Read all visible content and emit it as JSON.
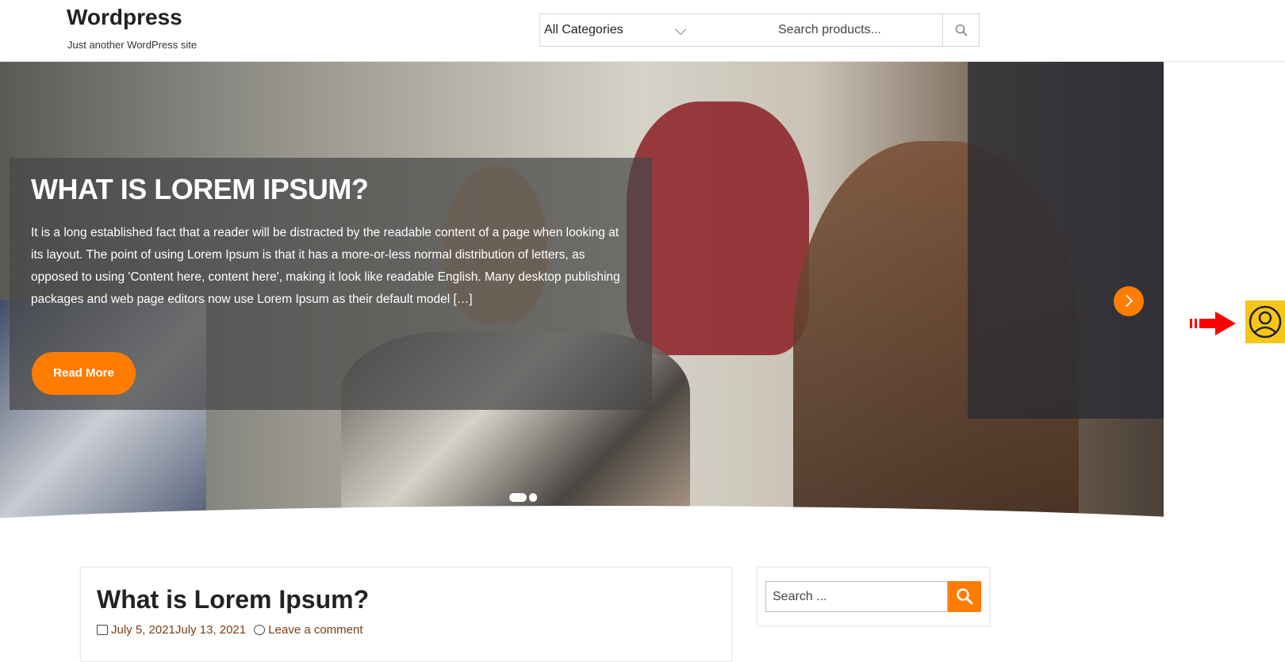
{
  "site": {
    "title": "Wordpress",
    "tagline": "Just another WordPress site"
  },
  "header_search": {
    "category_selected": "All Categories",
    "placeholder": "Search products..."
  },
  "hero": {
    "title": "WHAT IS LOREM IPSUM?",
    "text": "It is a long established fact that a reader will be distracted by the readable content of a page when looking at its layout. The point of using Lorem Ipsum is that it has a more-or-less normal distribution of letters, as opposed to using 'Content here, content here', making it look like readable English. Many desktop publishing packages and web page editors now use Lorem Ipsum as their default model […]",
    "button_label": "Read More",
    "slide_count": 2,
    "active_slide": 1
  },
  "post": {
    "title": "What is Lorem Ipsum?",
    "date": "July 5, 2021July 13, 2021",
    "comment_link": "Leave a comment"
  },
  "sidebar_search": {
    "placeholder": "Search ..."
  },
  "colors": {
    "accent": "#ff7c00",
    "account_bg": "#f5c518",
    "arrow": "#ff0000"
  },
  "icons": [
    "search-icon",
    "chevron-down-icon",
    "chevron-right-icon",
    "calendar-icon",
    "comment-icon",
    "user-circle-icon",
    "arrow-right-icon"
  ]
}
